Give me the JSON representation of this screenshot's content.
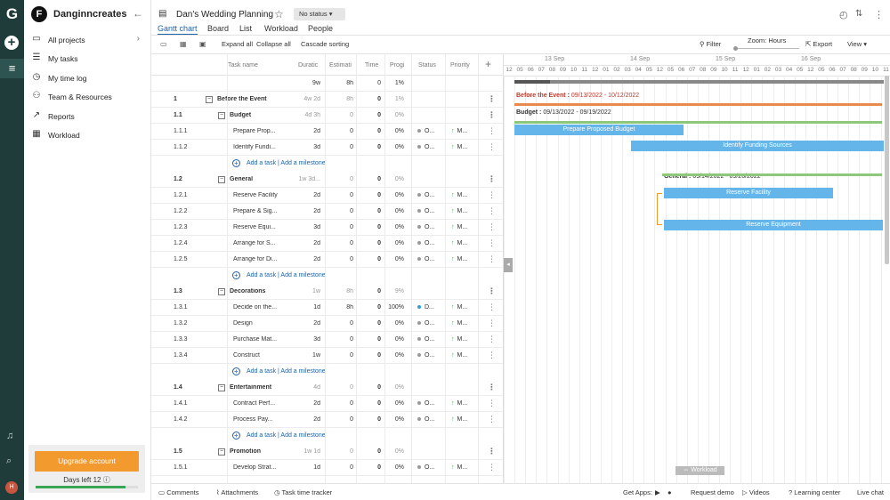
{
  "rail": {
    "logo": "G",
    "user_initial": "H"
  },
  "sidebar": {
    "workspace_initial": "F",
    "workspace_name": "Danginncreates",
    "items": [
      {
        "icon": "folder-icon",
        "glyph": "▭",
        "label": "All projects"
      },
      {
        "icon": "tasks-icon",
        "glyph": "☰",
        "label": "My tasks"
      },
      {
        "icon": "clock-icon",
        "glyph": "◷",
        "label": "My time log"
      },
      {
        "icon": "team-icon",
        "glyph": "⚇",
        "label": "Team & Resources"
      },
      {
        "icon": "reports-icon",
        "glyph": "↗",
        "label": "Reports"
      },
      {
        "icon": "workload-icon",
        "glyph": "▦",
        "label": "Workload"
      }
    ],
    "upgrade_label": "Upgrade account",
    "days_left": "Days left 12",
    "trial_progress": 0.88
  },
  "header": {
    "title": "Dan's Wedding Planning",
    "status": "No status",
    "tabs": [
      "Gantt chart",
      "Board",
      "List",
      "Workload",
      "People"
    ]
  },
  "toolbar": {
    "expand": "Expand all",
    "collapse": "Collapse all",
    "cascade": "Cascade sorting",
    "filter": "Filter",
    "zoom": "Zoom: Hours",
    "export": "Export",
    "view": "View"
  },
  "columns": {
    "name": "Task name",
    "duration": "Duratic",
    "estimate": "Estimati",
    "time": "Time",
    "progress": "Progi",
    "status": "Status",
    "priority": "Priority"
  },
  "total_row": {
    "duration": "9w",
    "estimate": "8h",
    "time": "0",
    "progress": "1%"
  },
  "rows": [
    {
      "type": "section",
      "level": 0,
      "num": "1",
      "name": "Before the Event",
      "duration": "4w 2d",
      "estimate": "8h",
      "time": "0",
      "progress": "1%"
    },
    {
      "type": "section",
      "level": 1,
      "num": "1.1",
      "name": "Budget",
      "duration": "4d 3h",
      "estimate": "0",
      "time": "0",
      "progress": "0%"
    },
    {
      "type": "task",
      "num": "1.1.1",
      "name": "Prepare Prop...",
      "duration": "2d",
      "estimate": "0",
      "time": "0",
      "progress": "0%",
      "status": "O...",
      "priority": "M..."
    },
    {
      "type": "task",
      "num": "1.1.2",
      "name": "Identify Fundi...",
      "duration": "3d",
      "estimate": "0",
      "time": "0",
      "progress": "0%",
      "status": "O...",
      "priority": "M..."
    },
    {
      "type": "add",
      "task": "Add a task",
      "milestone": "Add a milestone"
    },
    {
      "type": "section",
      "level": 1,
      "num": "1.2",
      "name": "General",
      "duration": "1w 3d...",
      "estimate": "0",
      "time": "0",
      "progress": "0%"
    },
    {
      "type": "task",
      "num": "1.2.1",
      "name": "Reserve Facility",
      "duration": "2d",
      "estimate": "0",
      "time": "0",
      "progress": "0%",
      "status": "O...",
      "priority": "M..."
    },
    {
      "type": "task",
      "num": "1.2.2",
      "name": "Prepare & Sig...",
      "duration": "2d",
      "estimate": "0",
      "time": "0",
      "progress": "0%",
      "status": "O...",
      "priority": "M..."
    },
    {
      "type": "task",
      "num": "1.2.3",
      "name": "Reserve Equi...",
      "duration": "3d",
      "estimate": "0",
      "time": "0",
      "progress": "0%",
      "status": "O...",
      "priority": "M..."
    },
    {
      "type": "task",
      "num": "1.2.4",
      "name": "Arrange for S...",
      "duration": "2d",
      "estimate": "0",
      "time": "0",
      "progress": "0%",
      "status": "O...",
      "priority": "M..."
    },
    {
      "type": "task",
      "num": "1.2.5",
      "name": "Arrange for Di...",
      "duration": "2d",
      "estimate": "0",
      "time": "0",
      "progress": "0%",
      "status": "O...",
      "priority": "M..."
    },
    {
      "type": "add",
      "task": "Add a task",
      "milestone": "Add a milestone"
    },
    {
      "type": "section",
      "level": 1,
      "num": "1.3",
      "name": "Decorations",
      "duration": "1w",
      "estimate": "8h",
      "time": "0",
      "progress": "9%"
    },
    {
      "type": "task",
      "num": "1.3.1",
      "name": "Decide on the...",
      "duration": "1d",
      "estimate": "8h",
      "time": "0",
      "progress": "100%",
      "status": "D...",
      "priority": "M...",
      "blue": true
    },
    {
      "type": "task",
      "num": "1.3.2",
      "name": "Design",
      "duration": "2d",
      "estimate": "0",
      "time": "0",
      "progress": "0%",
      "status": "O...",
      "priority": "M..."
    },
    {
      "type": "task",
      "num": "1.3.3",
      "name": "Purchase Mat...",
      "duration": "3d",
      "estimate": "0",
      "time": "0",
      "progress": "0%",
      "status": "O...",
      "priority": "M..."
    },
    {
      "type": "task",
      "num": "1.3.4",
      "name": "Construct",
      "duration": "1w",
      "estimate": "0",
      "time": "0",
      "progress": "0%",
      "status": "O...",
      "priority": "M..."
    },
    {
      "type": "add",
      "task": "Add a task",
      "milestone": "Add a milestone"
    },
    {
      "type": "section",
      "level": 1,
      "num": "1.4",
      "name": "Entertainment",
      "duration": "4d",
      "estimate": "0",
      "time": "0",
      "progress": "0%"
    },
    {
      "type": "task",
      "num": "1.4.1",
      "name": "Contract Perf...",
      "duration": "2d",
      "estimate": "0",
      "time": "0",
      "progress": "0%",
      "status": "O...",
      "priority": "M..."
    },
    {
      "type": "task",
      "num": "1.4.2",
      "name": "Process Pay...",
      "duration": "2d",
      "estimate": "0",
      "time": "0",
      "progress": "0%",
      "status": "O...",
      "priority": "M..."
    },
    {
      "type": "add",
      "task": "Add a task",
      "milestone": "Add a milestone"
    },
    {
      "type": "section",
      "level": 1,
      "num": "1.5",
      "name": "Promotion",
      "duration": "1w 1d",
      "estimate": "0",
      "time": "0",
      "progress": "0%"
    },
    {
      "type": "task",
      "num": "1.5.1",
      "name": "Develop Strat...",
      "duration": "1d",
      "estimate": "0",
      "time": "0",
      "progress": "0%",
      "status": "O...",
      "priority": "M..."
    }
  ],
  "gantt": {
    "weeks": [
      "13 Sep",
      "14 Sep",
      "15 Sep",
      "16 Sep"
    ],
    "hours": [
      "12",
      "05",
      "06",
      "07",
      "08",
      "09",
      "10",
      "11",
      "12",
      "01",
      "02",
      "03",
      "04",
      "05"
    ],
    "summaries": [
      {
        "label": "Before the Event",
        "dates": "09/13/2022 - 10/12/2022",
        "color": "#e8894d"
      },
      {
        "label": "Budget",
        "dates": "09/13/2022 - 09/19/2022",
        "color": "#8cc77a"
      },
      {
        "label": "General",
        "dates": "09/14/2022 - 09/26/2022",
        "color": "#8cc77a"
      }
    ],
    "bars": [
      {
        "label": "Prepare Proposed Budget"
      },
      {
        "label": "Identify Funding Sources"
      },
      {
        "label": "Reserve Facility"
      },
      {
        "label": "Reserve Equipment"
      }
    ],
    "workload": "Workload"
  },
  "footer": {
    "comments": "Comments",
    "attachments": "Attachments",
    "tracker": "Task time tracker",
    "apps": "Get Apps:",
    "demo": "Request demo",
    "videos": "Videos",
    "learning": "Learning center",
    "chat": "Live chat"
  }
}
